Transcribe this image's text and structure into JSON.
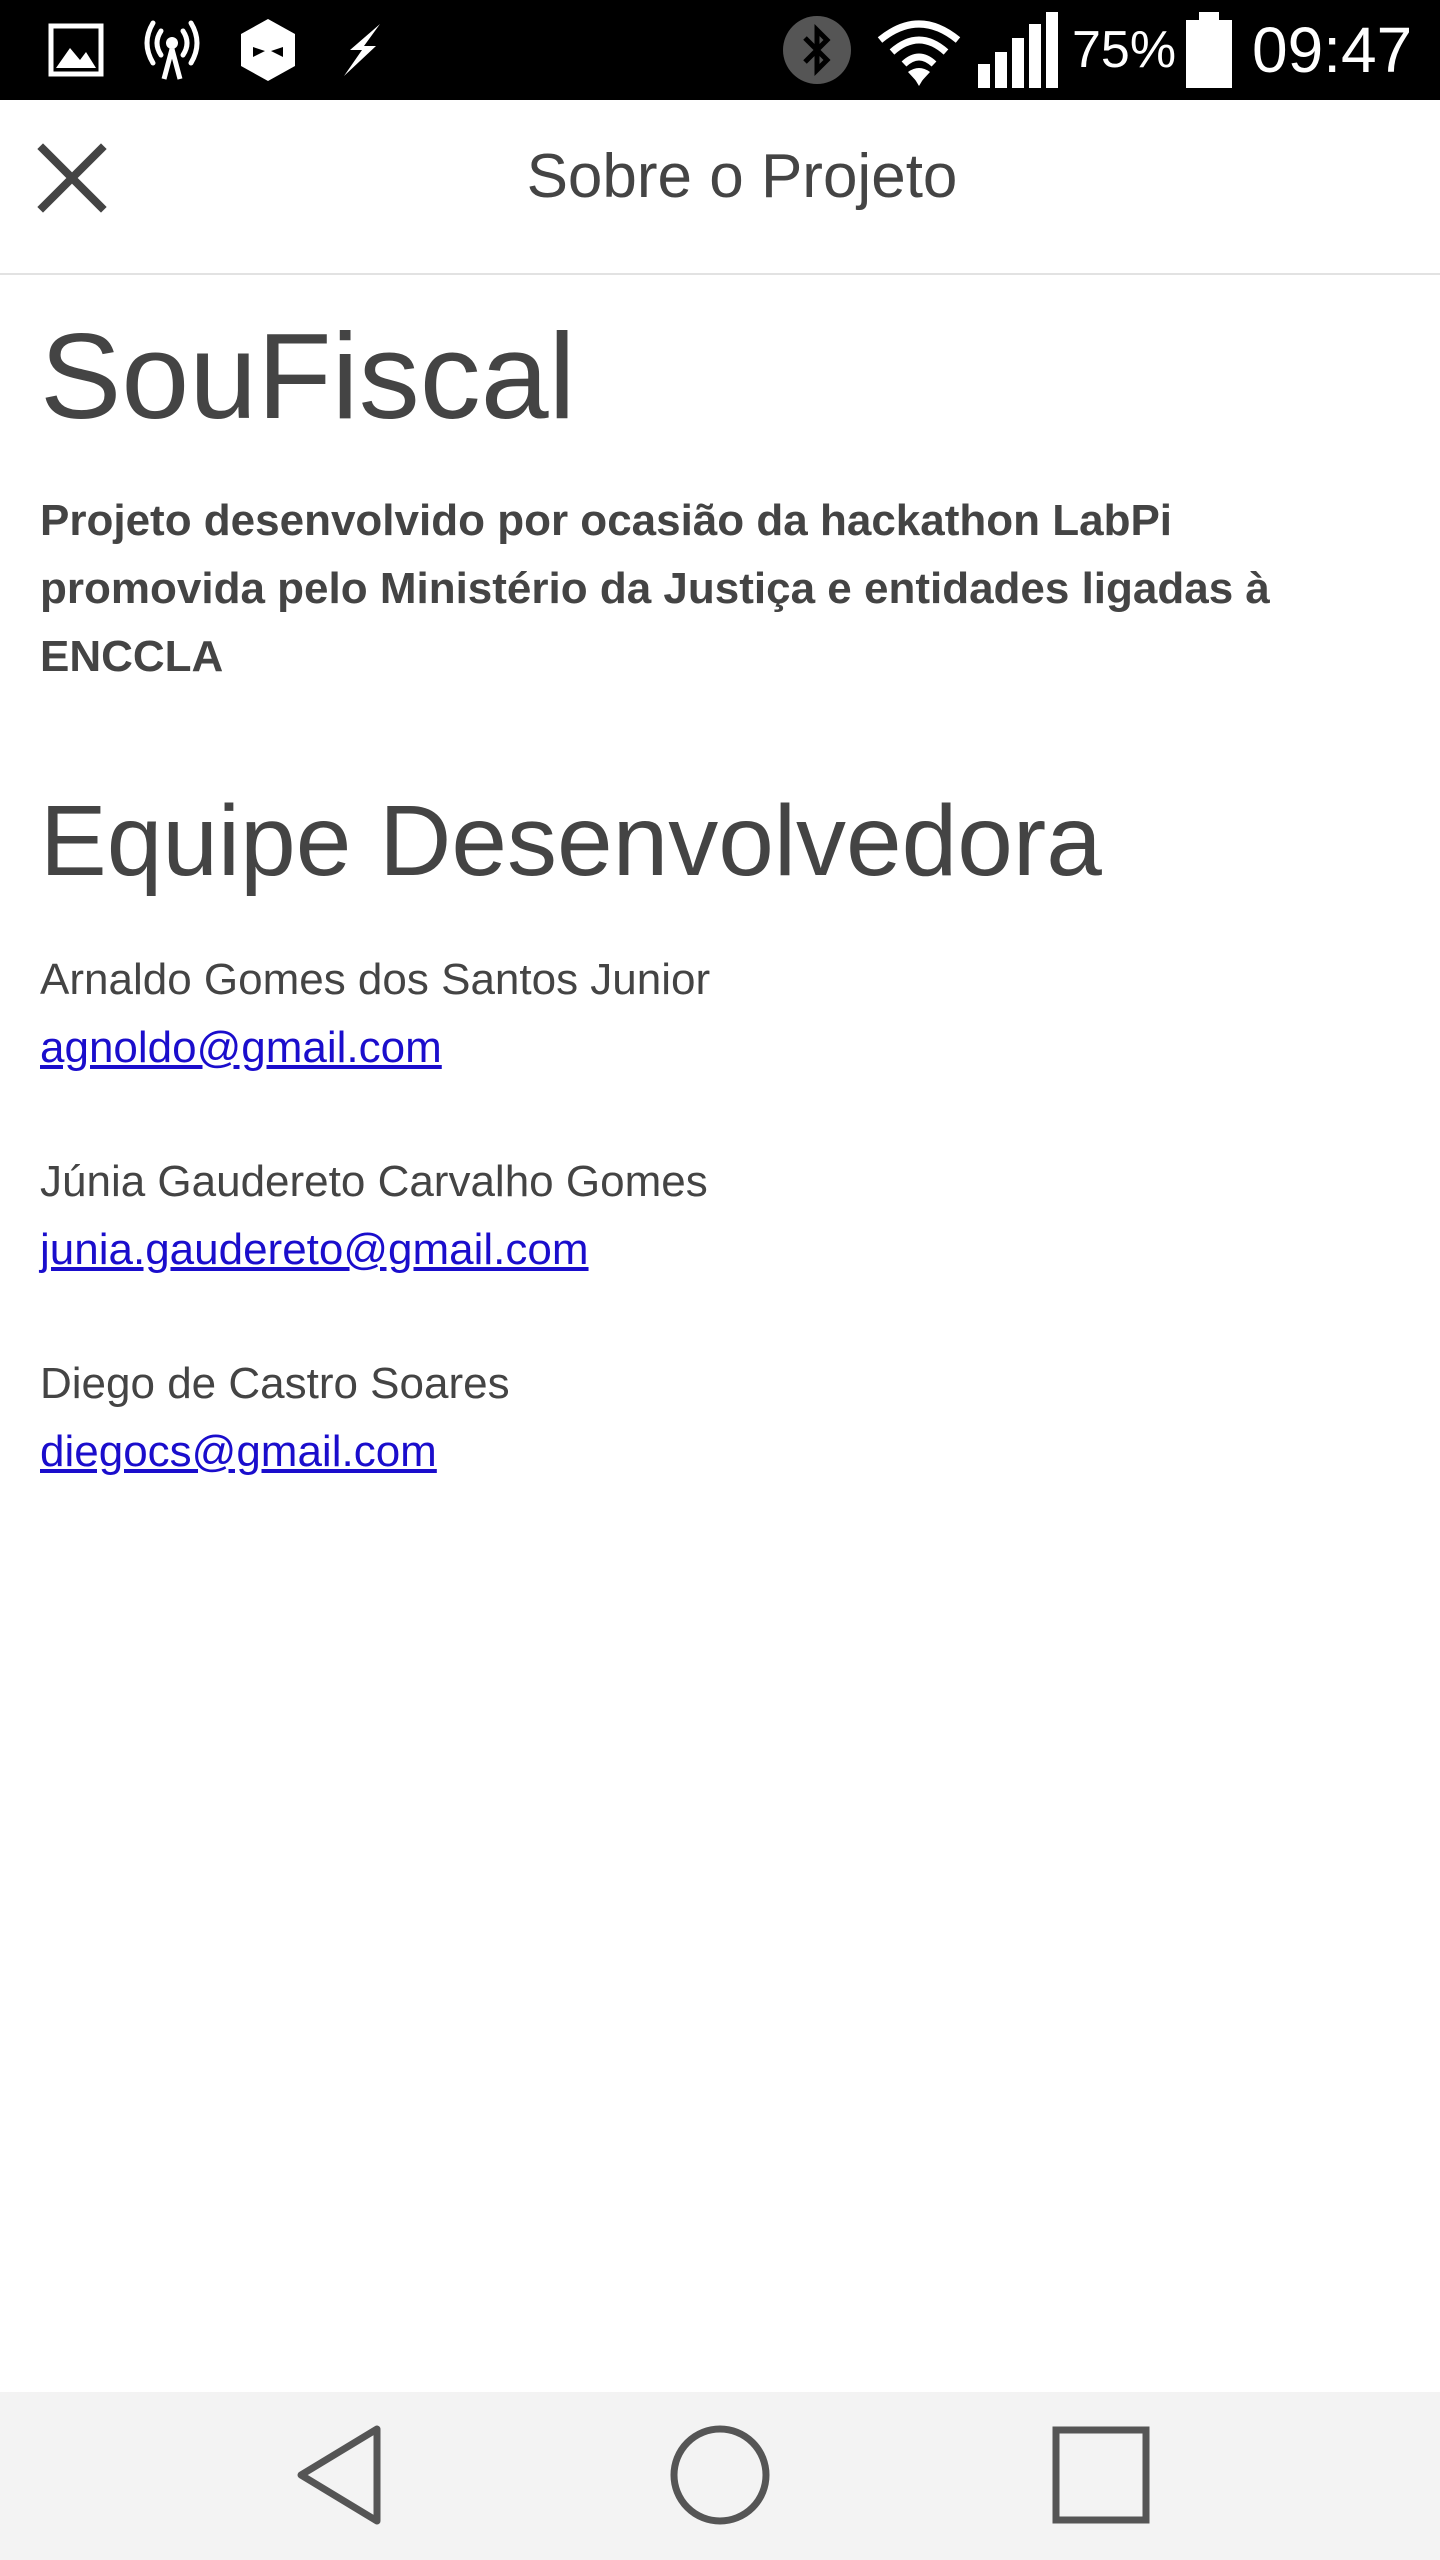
{
  "status_bar": {
    "battery_percent": "75%",
    "time": "09:47",
    "icons": [
      "image-icon",
      "hotspot-icon",
      "app-notification-icon",
      "charging-icon",
      "bluetooth-icon",
      "wifi-icon",
      "signal-icon",
      "battery-icon"
    ]
  },
  "app_bar": {
    "title": "Sobre o Projeto",
    "close_icon": "close-icon"
  },
  "content": {
    "app_name": "SouFiscal",
    "description": "Projeto desenvolvido por ocasião da hackathon LabPi promovida pelo Ministério da Justiça e entidades ligadas à ENCCLA",
    "team_title": "Equipe Desenvolvedora",
    "members": [
      {
        "name": "Arnaldo Gomes dos Santos Junior",
        "email": "agnoldo@gmail.com"
      },
      {
        "name": "Júnia Gaudereto Carvalho Gomes",
        "email": "junia.gaudereto@gmail.com"
      },
      {
        "name": "Diego de Castro Soares",
        "email": "diegocs@gmail.com"
      }
    ]
  },
  "nav_bar": {
    "icons": [
      "back-icon",
      "home-icon",
      "recents-icon"
    ]
  },
  "colors": {
    "status_bar_bg": "#000000",
    "text": "#444444",
    "link": "#1a0dcc",
    "nav_bar_bg": "#f3f3f3"
  }
}
